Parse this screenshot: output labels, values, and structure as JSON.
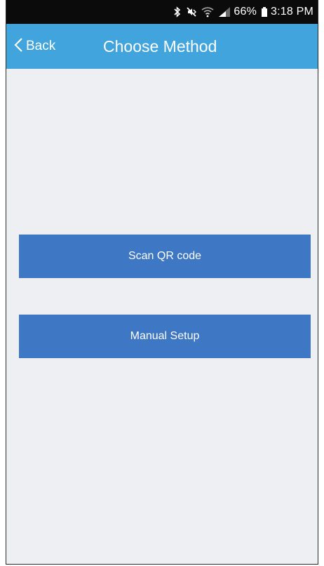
{
  "status_bar": {
    "icons": [
      "bluetooth-icon",
      "mute-icon",
      "wifi-icon",
      "signal-icon",
      "battery-icon"
    ],
    "battery_percent": "66%",
    "time": "3:18 PM"
  },
  "nav": {
    "back_label": "Back",
    "title": "Choose Method"
  },
  "buttons": {
    "scan_qr": "Scan QR code",
    "manual_setup": "Manual Setup"
  },
  "colors": {
    "nav_bar": "#41a4dd",
    "button": "#3e77c4",
    "background": "#eeeff2",
    "status_bar": "#0b0b0b"
  }
}
